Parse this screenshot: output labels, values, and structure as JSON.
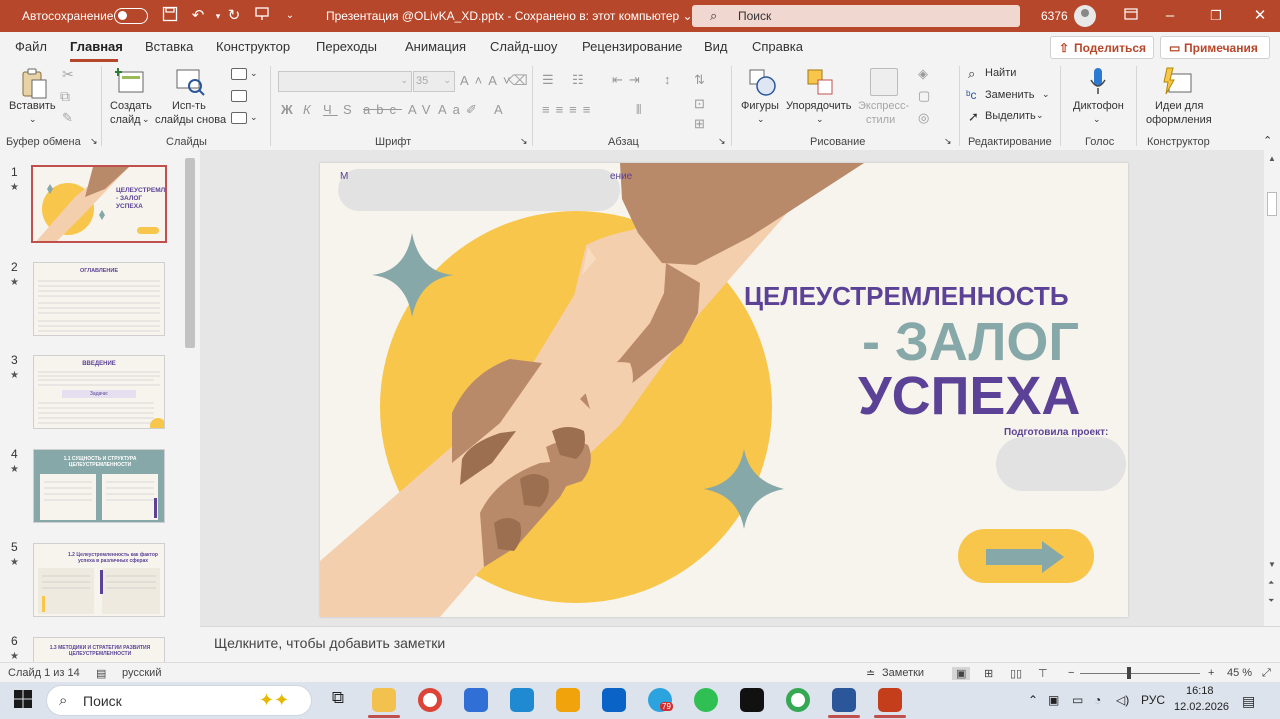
{
  "window": {
    "autosave_label": "Автосохранение",
    "title": "Презентация @OLivKA_XD.pptx  -  Сохранено в: этот компьютер  ⌄",
    "search_placeholder": "Поиск",
    "user_count": "6376"
  },
  "menu": {
    "tabs": [
      "Файл",
      "Главная",
      "Вставка",
      "Конструктор",
      "Переходы",
      "Анимация",
      "Слайд-шоу",
      "Рецензирование",
      "Вид",
      "Справка"
    ],
    "active_tab": "Главная",
    "share_label": "Поделиться",
    "notes_label": "Примечания"
  },
  "ribbon": {
    "paste_label": "Вставить",
    "clipboard_group": "Буфер обмена",
    "new_slide_label_1": "Создать",
    "new_slide_label_2": "слайд",
    "reuse_label_1": "Исп-ть",
    "reuse_label_2": "слайды снова",
    "slides_group": "Слайды",
    "font_size": "35",
    "font_group": "Шрифт",
    "paragraph_group": "Абзац",
    "shapes_label": "Фигуры",
    "arrange_label": "Упорядочить",
    "quick_styles_1": "Экспресс-",
    "quick_styles_2": "стили",
    "drawing_group": "Рисование",
    "find_label": "Найти",
    "replace_label": "Заменить",
    "select_label": "Выделить",
    "editing_group": "Редактирование",
    "dictate_label": "Диктофон",
    "voice_group": "Голос",
    "designer_label_1": "Идеи для",
    "designer_label_2": "оформления",
    "designer_group": "Конструктор"
  },
  "thumbnails": {
    "numbers": [
      "1",
      "2",
      "3",
      "4",
      "5",
      "6"
    ],
    "star": "★",
    "t1_title": "ЦЕЛЕУСТРЕМЛЕННОСТЬ - ЗАЛОГ УСПЕХА",
    "t2_title": "ОГЛАВЛЕНИЕ",
    "t3_title": "ВВЕДЕНИЕ",
    "t3_sub": "Задачи:",
    "t4_title": "1.1 СУЩНОСТЬ И СТРУКТУРА ЦЕЛЕУСТРЕМЛЕННОСТИ",
    "t5_title": "1.2 Целеустремленность как фактор успеха в различных сферах",
    "t6_title": "1.3 МЕТОДИКИ И СТРАТЕГИИ РАЗВИТИЯ ЦЕЛЕУСТРЕМЛЕННОСТИ"
  },
  "slide": {
    "top_text_start": "М",
    "top_text_end": "ение",
    "title_line1": "ЦЕЛЕУСТРЕМЛЕННОСТЬ",
    "title_line2": "- ЗАЛОГ",
    "title_line3": "УСПЕХА",
    "prepared_by": "Подготовила проект:"
  },
  "notes": {
    "placeholder": "Щелкните, чтобы добавить заметки"
  },
  "status": {
    "slide_info": "Слайд 1 из 14",
    "language": "русский",
    "notes_button": "Заметки",
    "zoom": "45 %"
  },
  "taskbar": {
    "search_label": "Поиск",
    "lang": "РУС",
    "time": "16:18",
    "date": "12.02.2026",
    "telegram_badge": "79"
  },
  "colors": {
    "accent": "#b7472a",
    "slide_purple": "#5b4296",
    "slide_teal": "#86a8a8",
    "slide_yellow": "#f7c64a"
  }
}
